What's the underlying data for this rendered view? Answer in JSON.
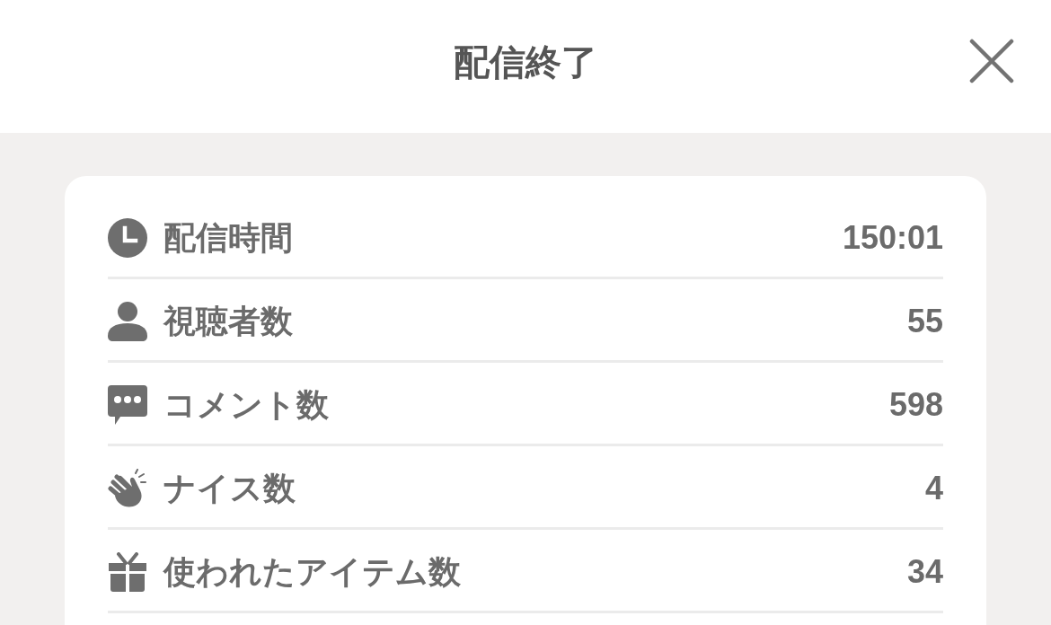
{
  "header": {
    "title": "配信終了"
  },
  "stats": [
    {
      "kind": "clock",
      "label": "配信時間",
      "value": "150:01"
    },
    {
      "kind": "person",
      "label": "視聴者数",
      "value": "55"
    },
    {
      "kind": "comment",
      "label": "コメント数",
      "value": "598"
    },
    {
      "kind": "clap",
      "label": "ナイス数",
      "value": "4"
    },
    {
      "kind": "gift",
      "label": "使われたアイテム数",
      "value": "34"
    }
  ]
}
